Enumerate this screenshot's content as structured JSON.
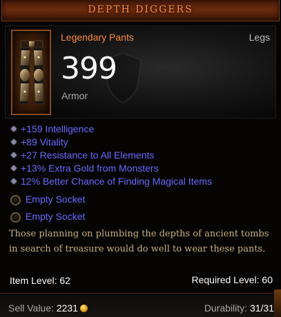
{
  "item": {
    "name": "DEPTH DIGGERS",
    "type": "Legendary Pants",
    "slot": "Legs",
    "armor_value": "399",
    "armor_label": "Armor",
    "icon": "pants-icon"
  },
  "affixes": [
    "+159 Intelligence",
    "+89 Vitality",
    "+27 Resistance to All Elements",
    "+13% Extra Gold from Monsters",
    "12% Better Chance of Finding Magical Items"
  ],
  "sockets": [
    "Empty Socket",
    "Empty Socket"
  ],
  "flavor_text": "Those planning on plumbing the depths of ancient tombs in search of treasure would do well to wear these pants.",
  "levels": {
    "item_level": "Item Level: 62",
    "required_level": "Required Level: 60"
  },
  "footer": {
    "sell_label": "Sell Value:",
    "sell_value": "2231",
    "durability_label": "Durability:",
    "durability_value": "31/31"
  },
  "colors": {
    "legendary": "#ff8a3c",
    "magic_affix": "#6969ff",
    "flavor": "#c8b37c",
    "label_gray": "#a8a8a8"
  }
}
